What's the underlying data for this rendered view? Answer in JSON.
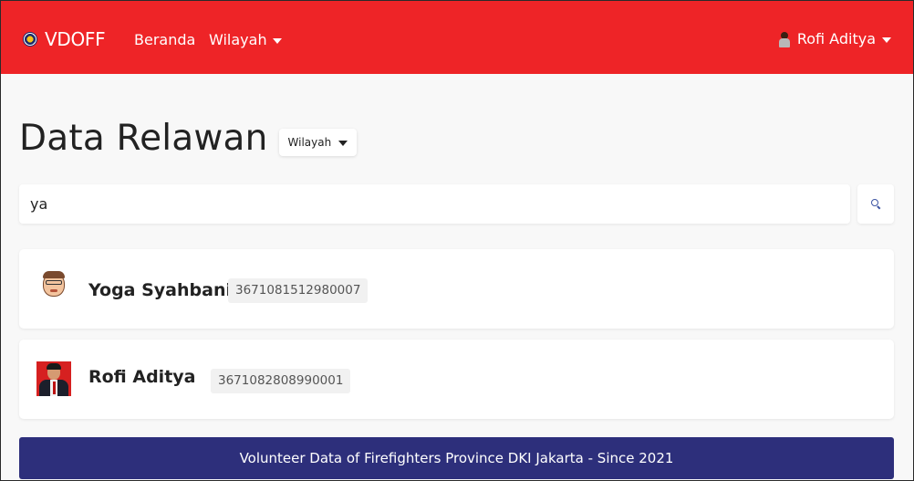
{
  "navbar": {
    "brand": "VDOFF",
    "links": [
      {
        "label": "Beranda",
        "dropdown": false
      },
      {
        "label": "Wilayah",
        "dropdown": true
      }
    ],
    "user": {
      "name": "Rofi Aditya",
      "dropdown": true
    }
  },
  "page": {
    "title": "Data Relawan",
    "filter_button": "Wilayah"
  },
  "search": {
    "value": "ya",
    "icon": "search-icon"
  },
  "results": [
    {
      "name": "Yoga Syahbani",
      "id": "3671081512980007",
      "avatar": "cartoon-avatar"
    },
    {
      "name": "Rofi Aditya",
      "id": "3671082808990001",
      "avatar": "photo-avatar"
    }
  ],
  "footer": {
    "text": "Volunteer Data of Firefighters Province DKI Jakarta - Since 2021"
  },
  "colors": {
    "navbar": "#ee2427",
    "footer": "#2d2f7b",
    "background": "#f8f8f8"
  }
}
